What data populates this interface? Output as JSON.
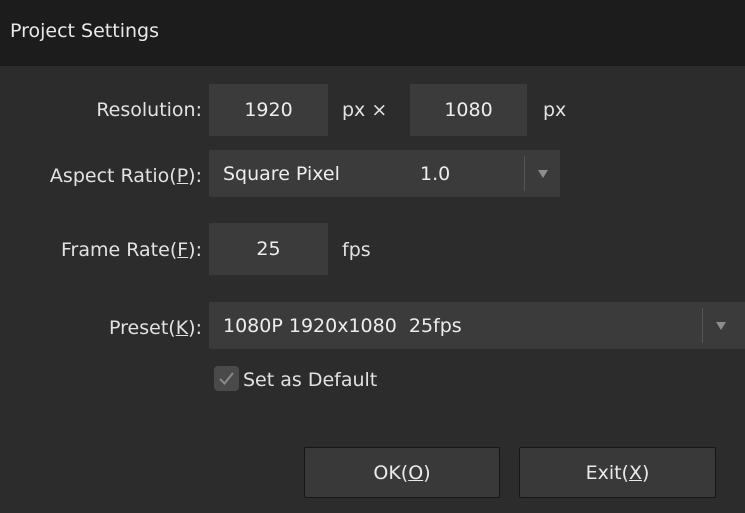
{
  "window": {
    "title": "Project Settings"
  },
  "resolution": {
    "label": "Resolution:",
    "width_value": "1920",
    "height_value": "1080",
    "px_times": "px ×",
    "px": "px"
  },
  "aspect_ratio": {
    "label_pre": "Aspect Ratio(",
    "label_key": "P",
    "label_post": "):",
    "selected": "Square Pixel",
    "ratio": "1.0"
  },
  "frame_rate": {
    "label_pre": "Frame Rate(",
    "label_key": "F",
    "label_post": "):",
    "value": "25",
    "unit": "fps"
  },
  "preset": {
    "label_pre": "Preset(",
    "label_key": "K",
    "label_post": "):",
    "selected": "1080P 1920x1080  25fps"
  },
  "default_checkbox": {
    "label": "Set as Default",
    "checked": true
  },
  "buttons": {
    "ok_pre": "OK(",
    "ok_key": "O",
    "ok_post": ")",
    "exit_pre": "Exit(",
    "exit_key": "X",
    "exit_post": ")"
  },
  "icons": {
    "dropdown": "chevron-down-icon",
    "check": "checkmark-icon"
  },
  "colors": {
    "window_bg": "#2c2c2c",
    "titlebar_bg": "#1c1c1c",
    "field_bg": "#3b3b3b",
    "button_bg": "#393939",
    "text": "#e2e2e2"
  }
}
